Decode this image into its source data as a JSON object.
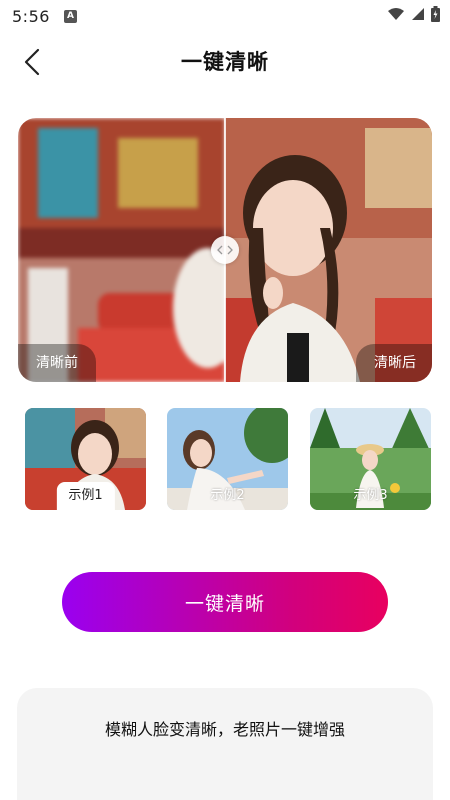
{
  "status_bar": {
    "time": "5:56",
    "notification_icon": "a-icon"
  },
  "header": {
    "title": "一键清晰",
    "back_icon": "chevron-left-icon"
  },
  "comparison": {
    "before_label": "清晰前",
    "after_label": "清晰后"
  },
  "examples": [
    {
      "label": "示例1",
      "selected": true
    },
    {
      "label": "示例2",
      "selected": false
    },
    {
      "label": "示例3",
      "selected": false
    }
  ],
  "action": {
    "label": "一键清晰"
  },
  "info": {
    "text": "模糊人脸变清晰，老照片一键增强"
  },
  "colors": {
    "gradient_start": "#9a00f0",
    "gradient_end": "#e8005f"
  }
}
